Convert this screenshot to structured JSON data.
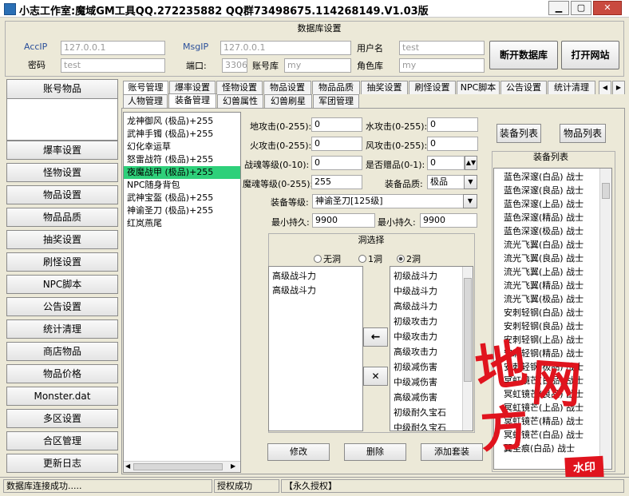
{
  "window": {
    "title": "小志工作室:魔域GM工具QQ.272235882 QQ群73498675.114268149.V1.03版",
    "min": "▁",
    "max": "▢",
    "close": "✕"
  },
  "db": {
    "group_title": "数据库设置",
    "acc_ip_label": "AccIP",
    "acc_ip": "127.0.0.1",
    "msg_ip_label": "MsgIP",
    "msg_ip": "127.0.0.1",
    "user_label": "用户名",
    "user": "test",
    "password_label": "密码",
    "password": "test",
    "port_label": "端口:",
    "port": "3306",
    "account_db_label": "账号库",
    "account_db": "my",
    "role_db_label": "角色库",
    "role_db": "my",
    "disconnect_btn": "断开数据库",
    "open_site_btn": "打开网站"
  },
  "sidebar": {
    "items": [
      "账号物品",
      "爆率设置",
      "怪物设置",
      "物品设置",
      "物品品质",
      "抽奖设置",
      "刷怪设置",
      "NPC脚本",
      "公告设置",
      "统计清理",
      "商店物品",
      "物品价格",
      "Monster.dat",
      "多区设置",
      "合区管理",
      "更新日志"
    ]
  },
  "tabs": {
    "top": [
      "账号管理",
      "爆率设置",
      "怪物设置",
      "物品设置",
      "物品品质",
      "抽奖设置",
      "刷怪设置",
      "NPC脚本",
      "公告设置",
      "统计清理"
    ],
    "sub": [
      "人物管理",
      "装备管理",
      "幻兽属性",
      "幻兽刷星",
      "军团管理"
    ],
    "arrow_left": "◀",
    "arrow_right": "▶"
  },
  "equip_list": {
    "items": [
      "龙神御风 (极品)+255",
      "武神手镯 (极品)+255",
      "幻化幸运草",
      "怒雷战符 (极品)+255",
      "夜魔战甲 (极品)+255",
      "NPC随身背包",
      "武神宝盔 (极品)+255",
      "神谕圣刀 (极品)+255",
      "红岚燕尾"
    ],
    "selected": 4
  },
  "form": {
    "earth_label": "地攻击(0-255):",
    "earth": "0",
    "water_label": "水攻击(0-255):",
    "water": "0",
    "fire_label": "火攻击(0-255):",
    "fire": "0",
    "wind_label": "风攻击(0-255):",
    "wind": "0",
    "forge_label": "战魂等级(0-10):",
    "forge": "0",
    "gift_label": "是否赠品(0-1):",
    "gift": "0",
    "soul_label": "魔魂等级(0-255):",
    "soul": "255",
    "quality_label": "装备品质:",
    "quality": "极品",
    "level_label": "装备等级:",
    "level": "神谕圣刀[125级]",
    "min_dur_label": "最小持久:",
    "min_dur": "9900",
    "max_dur_label": "最小持久:",
    "max_dur": "9900"
  },
  "holes": {
    "title": "洞选择",
    "opt0": "无洞",
    "opt1": "1洞",
    "opt2": "2洞",
    "selected_gems": [
      "高级战斗力",
      "高级战斗力"
    ],
    "gems": [
      "初级战斗力",
      "中级战斗力",
      "高级战斗力",
      "初级攻击力",
      "中级攻击力",
      "高级攻击力",
      "初级减伤害",
      "中级减伤害",
      "高级减伤害",
      "初级耐久宝石",
      "中级耐久宝石"
    ],
    "add_arrow": "←",
    "remove": "✕"
  },
  "actions": {
    "modify": "修改",
    "delete": "删除",
    "add_set": "添加套装"
  },
  "right": {
    "equip_list_btn": "装备列表",
    "item_list_btn": "物品列表",
    "list_title": "装备列表",
    "items": [
      "蓝色深邃(白品) 战士",
      "蓝色深邃(良品) 战士",
      "蓝色深邃(上品) 战士",
      "蓝色深邃(精品) 战士",
      "蓝色深邃(极品) 战士",
      "流光飞翼(白品) 战士",
      "流光飞翼(良品) 战士",
      "流光飞翼(上品) 战士",
      "流光飞翼(精品) 战士",
      "流光飞翼(极品) 战士",
      "安刺轻钢(白品) 战士",
      "安刺轻钢(良品) 战士",
      "安刺轻钢(上品) 战士",
      "安刺轻钢(精品) 战士",
      "安刺轻钢(极品) 战士",
      "冥虹镜芒(白品) 战士",
      "冥虹镜芒(良品) 战士",
      "冥虹镜芒(上品) 战士",
      "冥虹镜芒(精品) 战士",
      "冥虹镜芒(白品) 战士",
      "翼圣痕(白品) 战士"
    ]
  },
  "status": {
    "left": "数据库连接成功.....",
    "mid": "授权成功",
    "right": "【永久授权】"
  },
  "watermark": {
    "c1": "地",
    "c2": "网",
    "c3": "方",
    "tag": "水印"
  }
}
